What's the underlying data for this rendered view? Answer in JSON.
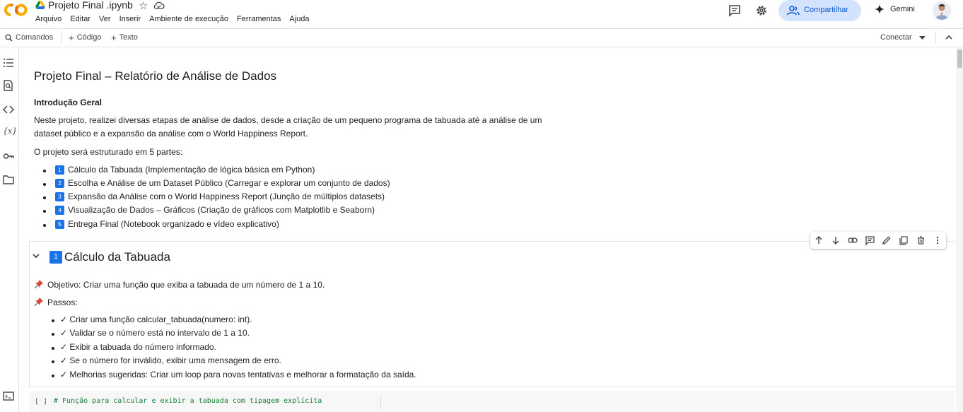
{
  "header": {
    "notebook_title": "Projeto Final .ipynb",
    "menu": [
      "Arquivo",
      "Editar",
      "Ver",
      "Inserir",
      "Ambiente de execução",
      "Ferramentas",
      "Ajuda"
    ],
    "share_label": "Compartilhar",
    "gemini_label": "Gemini"
  },
  "toolbar": {
    "commands_label": "Comandos",
    "code_label": "Código",
    "text_label": "Texto",
    "connect_label": "Conectar"
  },
  "sidebar": {
    "icons": [
      "table-of-contents-icon",
      "find-icon",
      "code-snippets-icon",
      "variables-icon",
      "secrets-key-icon",
      "folder-icon"
    ]
  },
  "notebook": {
    "title": "Projeto Final – Relatório de Análise de Dados",
    "intro_heading": "Introdução Geral",
    "intro_line1": "Neste projeto, realizei diversas etapas de análise de dados, desde a criação de um pequeno programa de tabuada até a análise de um",
    "intro_line2": "dataset público e a expansão da análise com o World Happiness Report.",
    "structure_text": "O projeto será estruturado em 5 partes:",
    "parts": [
      {
        "num": "1",
        "text": "Cálculo da Tabuada (Implementação de lógica básica em Python)"
      },
      {
        "num": "2",
        "text": "Escolha e Análise de um Dataset Público (Carregar e explorar um conjunto de dados)"
      },
      {
        "num": "3",
        "text": "Expansão da Análise com o World Happiness Report (Junção de múltiplos datasets)"
      },
      {
        "num": "4",
        "text": "Visualização de Dados – Gráficos (Criação de gráficos com Matplotlib e Seaborn)"
      },
      {
        "num": "5",
        "text": "Entrega Final (Notebook organizado e vídeo explicativo)"
      }
    ],
    "section1": {
      "num": "1",
      "title": "Cálculo da Tabuada",
      "objective": "Objetivo: Criar uma função que exiba a tabuada de um número de 1 a 10.",
      "steps_label": "Passos:",
      "steps": [
        "✓ Criar uma função calcular_tabuada(numero: int).",
        "✓ Validar se o número está no intervalo de 1 a 10.",
        "✓ Exibir a tabuada do número informado.",
        "✓ Se o número for inválido, exibir uma mensagem de erro.",
        "✓ Melhorias sugeridas: Criar um loop para novas tentativas e melhorar a formatação da saída."
      ]
    },
    "code_cell": {
      "run_marker": "[ ]",
      "first_line": "# Função para calcular e exibir a tabuada com tipagem explícita"
    }
  }
}
